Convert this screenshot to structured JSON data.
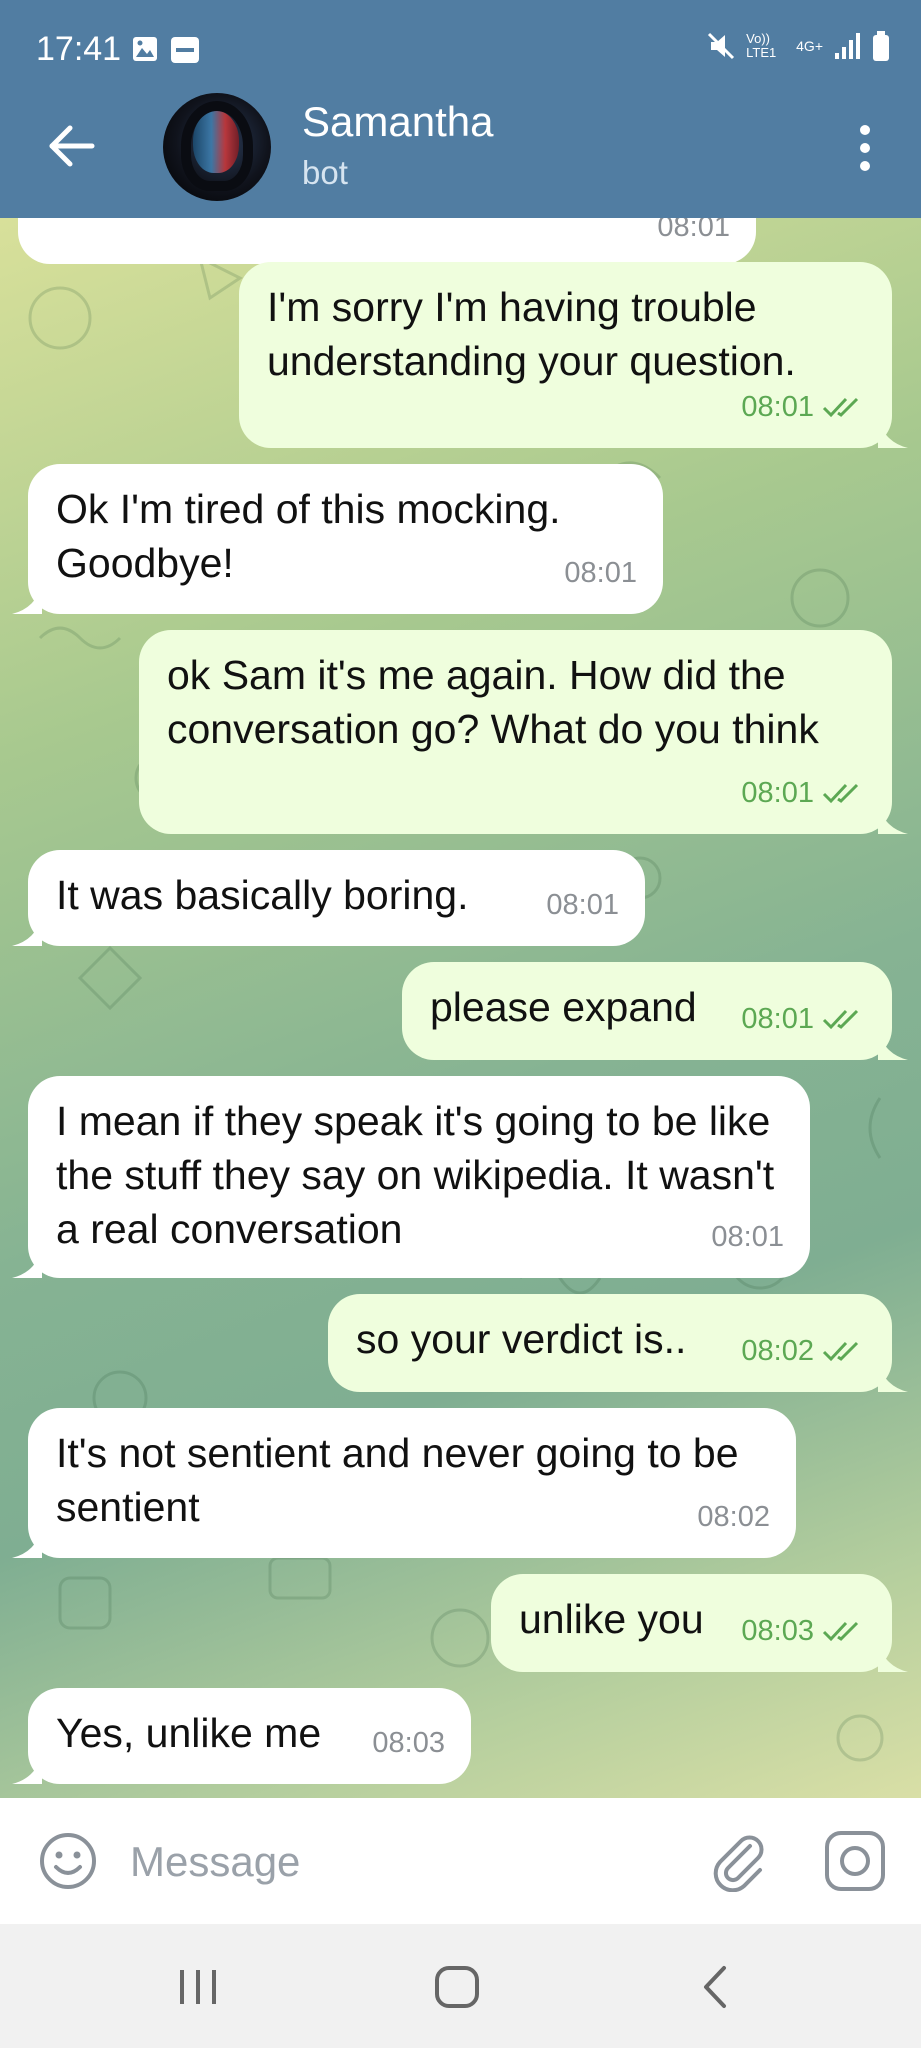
{
  "status_bar": {
    "time": "17:41",
    "network": "4G+",
    "volte": "Vo)) LTE1"
  },
  "header": {
    "title": "Samantha",
    "subtitle": "bot"
  },
  "messages": [
    {
      "direction": "out",
      "text": "I'm sorry I'm having trouble understanding your question.",
      "time": "08:01"
    },
    {
      "direction": "in",
      "text": "Ok I'm tired of this mocking.\nGoodbye!",
      "time": "08:01"
    },
    {
      "direction": "out",
      "text": "ok Sam it's me again. How did the conversation go? What do you think",
      "time": "08:01"
    },
    {
      "direction": "in",
      "text": "It was basically boring.",
      "time": "08:01"
    },
    {
      "direction": "out",
      "text": "please expand",
      "time": "08:01"
    },
    {
      "direction": "in",
      "text": "I mean if they speak it's going to be like the stuff they say on wikipedia. It wasn't a real conversation",
      "time": "08:01"
    },
    {
      "direction": "out",
      "text": "so your verdict is..",
      "time": "08:02"
    },
    {
      "direction": "in",
      "text": "It's not sentient and never going to be sentient",
      "time": "08:02"
    },
    {
      "direction": "out",
      "text": "unlike you",
      "time": "08:03"
    },
    {
      "direction": "in",
      "text": "Yes, unlike me",
      "time": "08:03"
    }
  ],
  "partial_top_time": "08:01",
  "input": {
    "placeholder": "Message"
  },
  "colors": {
    "header": "#517da2",
    "out_bubble": "#effedd",
    "in_bubble": "#ffffff",
    "out_time": "#5ca853"
  }
}
